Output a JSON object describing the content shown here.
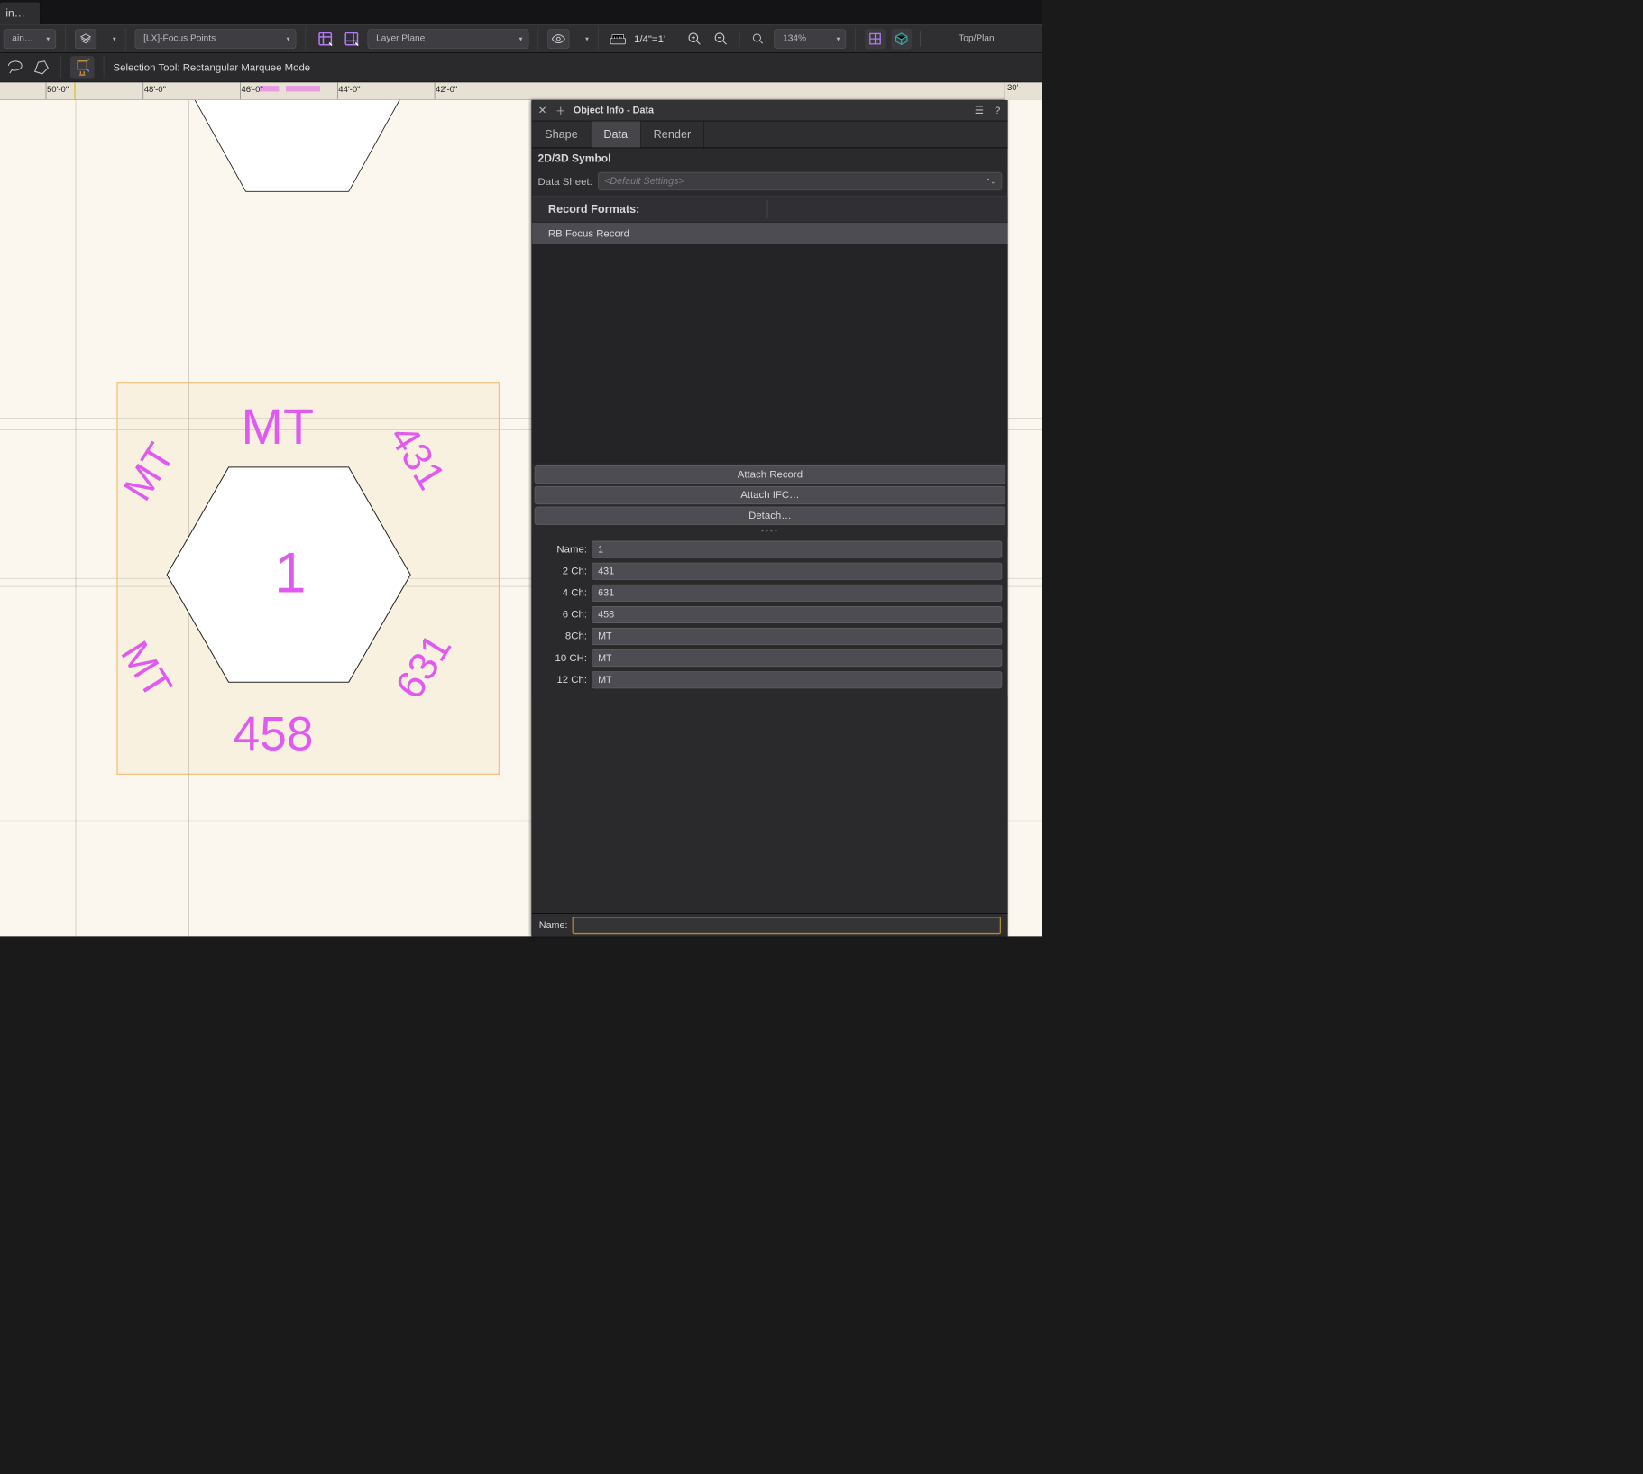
{
  "title_tab": "in…",
  "viewbar": {
    "active_label": "ain…",
    "class_dropdown": "[LX]-Focus Points",
    "plane_dropdown": "Layer Plane",
    "scale": "1/4\"=1'",
    "zoom": "134%",
    "view": "Top/Plan"
  },
  "toolbar": {
    "tool_desc": "Selection Tool: Rectangular Marquee Mode"
  },
  "ruler": {
    "ticks": [
      "50'-0\"",
      "48'-0\"",
      "46'-0\"",
      "44'-0\"",
      "42'-0\""
    ],
    "right_tick": "30'-"
  },
  "canvas": {
    "symbol_center": "1",
    "labels": {
      "top": "MT",
      "top_right": "431",
      "bot_right": "631",
      "bottom": "458",
      "bot_left": "MT",
      "top_left": "MT"
    }
  },
  "panel": {
    "title": "Object Info - Data",
    "tabs": {
      "shape": "Shape",
      "data": "Data",
      "render": "Render"
    },
    "subtitle": "2D/3D Symbol",
    "datasheet_label": "Data Sheet:",
    "datasheet_value": "<Default Settings>",
    "record_formats_label": "Record Formats:",
    "record_item": "RB Focus Record",
    "btn_attach_record": "Attach Record",
    "btn_attach_ifc": "Attach IFC…",
    "btn_detach": "Detach…",
    "fields": [
      {
        "label": "Name:",
        "value": "1"
      },
      {
        "label": "2 Ch:",
        "value": "431"
      },
      {
        "label": "4 Ch:",
        "value": "631"
      },
      {
        "label": "6 Ch:",
        "value": "458"
      },
      {
        "label": "8Ch:",
        "value": "MT"
      },
      {
        "label": "10 CH:",
        "value": "MT"
      },
      {
        "label": "12 Ch:",
        "value": "MT"
      }
    ],
    "footer_label": "Name:",
    "footer_value": ""
  }
}
